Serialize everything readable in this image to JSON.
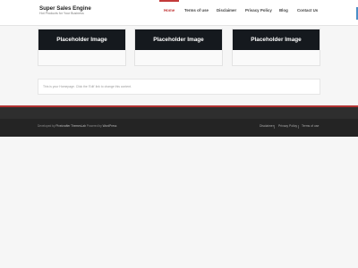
{
  "site": {
    "title": "Super Sales Engine",
    "tagline": "Hot Products for Your Business"
  },
  "nav": {
    "items": [
      {
        "label": "Home",
        "active": true
      },
      {
        "label": "Terms of use",
        "active": false
      },
      {
        "label": "Disclaimer",
        "active": false
      },
      {
        "label": "Privacy Policy",
        "active": false
      },
      {
        "label": "Blog",
        "active": false
      },
      {
        "label": "Contact Us",
        "active": false
      }
    ]
  },
  "cards": [
    {
      "label": "Placeholder Image"
    },
    {
      "label": "Placeholder Image"
    },
    {
      "label": "Placeholder Image"
    }
  ],
  "notice": {
    "text": "This is your Homepage. Click the 'Edit' link to change this content."
  },
  "footer": {
    "credits_prefix": "Developed by ",
    "credits_author": "Pixelcrafter ThemesLab",
    "credits_middle": " Powered by ",
    "credits_platform": "WordPress",
    "links": [
      {
        "label": "Disclaimer"
      },
      {
        "label": "Privacy Policy"
      },
      {
        "label": "Terms of use"
      }
    ]
  },
  "colors": {
    "accent": "#c23a3a",
    "header_edge": "#4a8fc7",
    "card_image_bg": "#15191e",
    "footer_bg": "#2e2e2e"
  }
}
